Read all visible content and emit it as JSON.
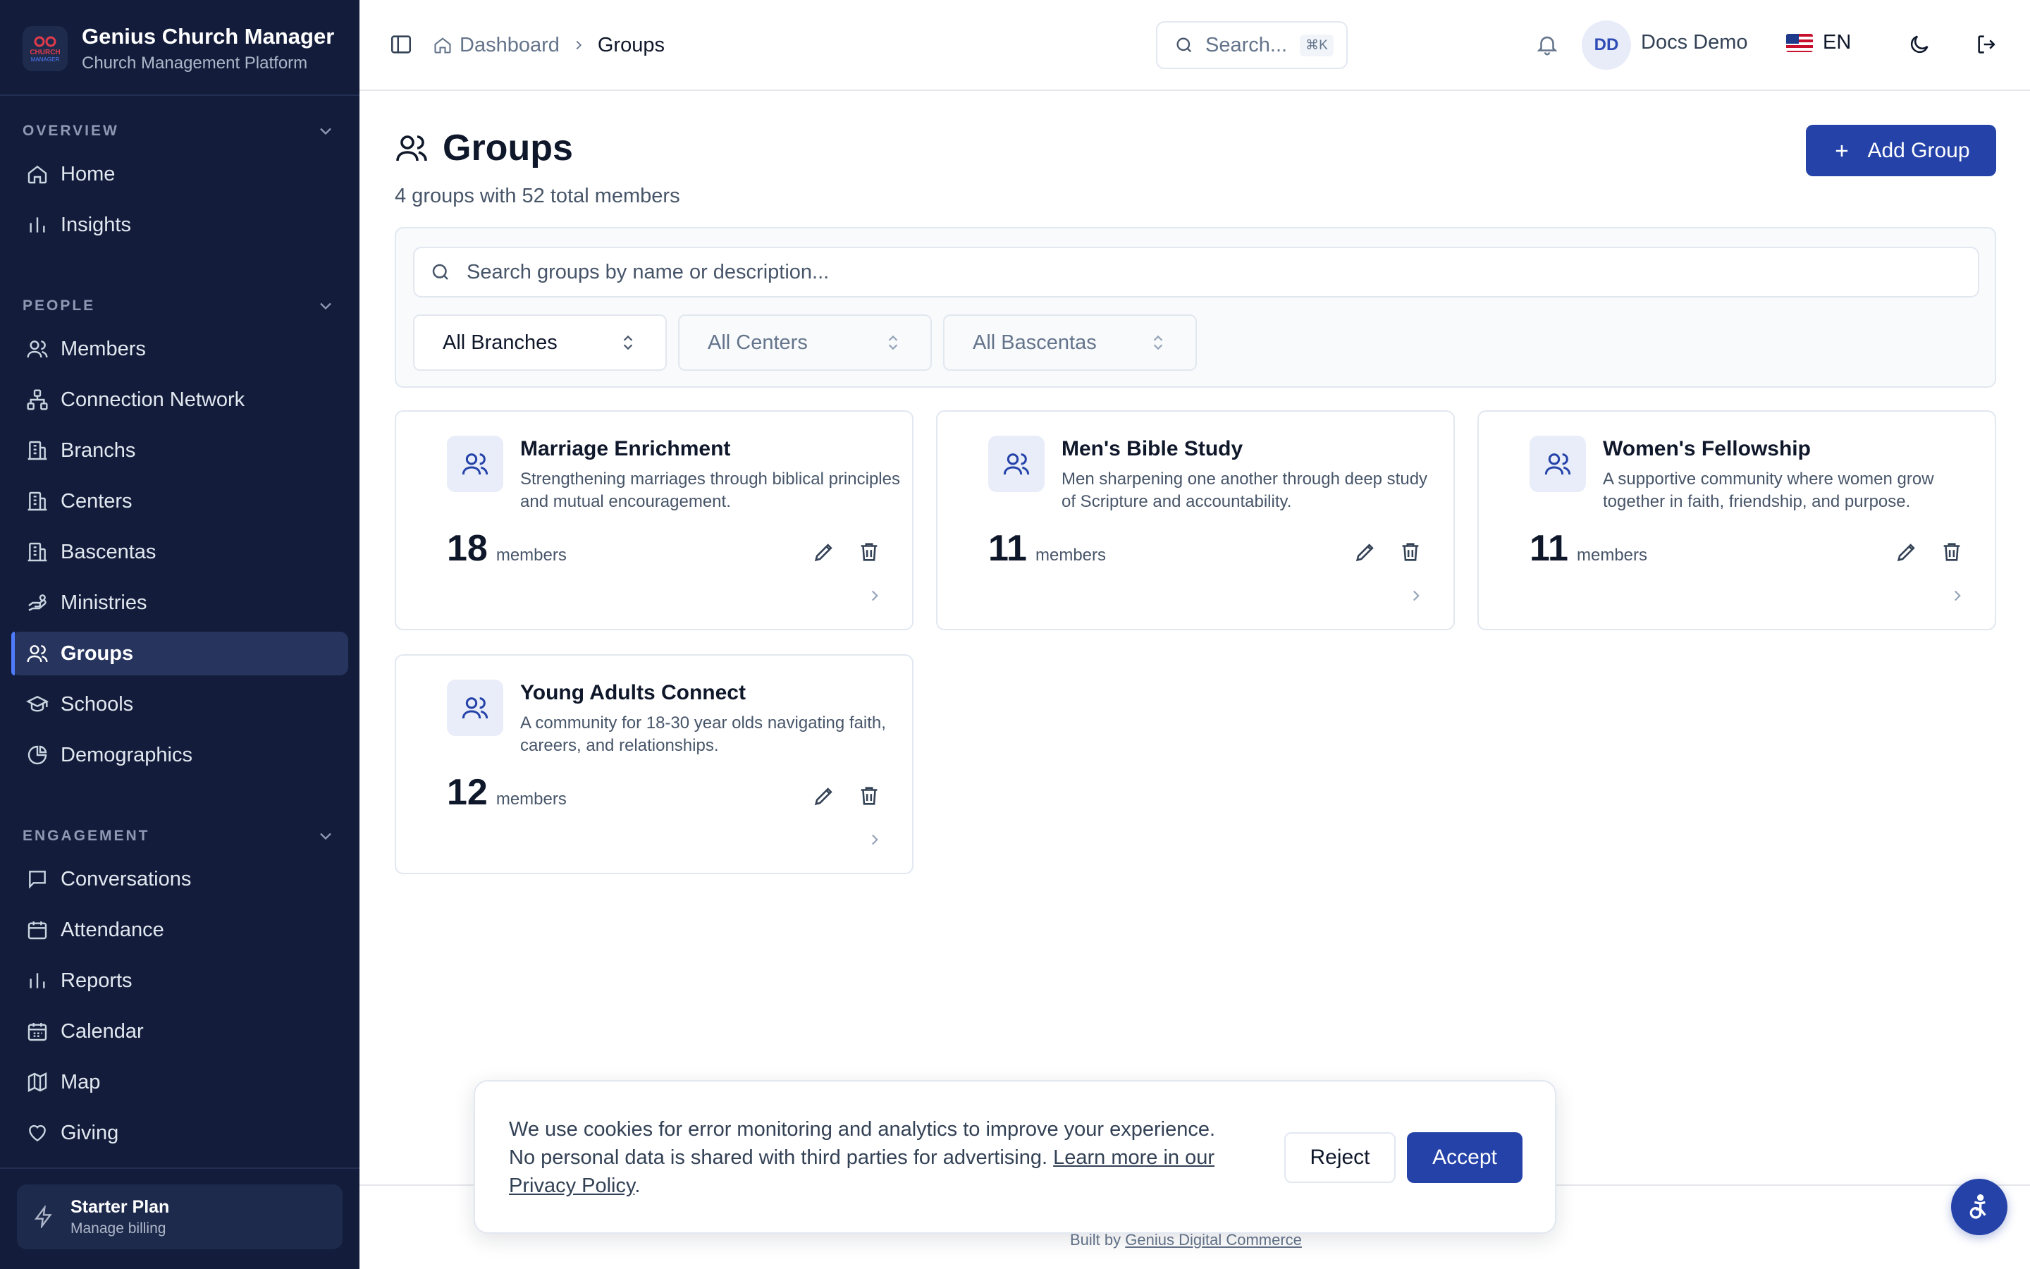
{
  "app": {
    "title": "Genius Church Manager",
    "subtitle": "Church Management Platform",
    "logo_top": "CHURCH",
    "logo_bottom": "MANAGER",
    "accent_color": "#2442a8",
    "sidebar_color": "#131d3b"
  },
  "sidebar": {
    "sections": [
      {
        "label": "OVERVIEW",
        "items": [
          {
            "label": "Home",
            "icon": "home-icon"
          },
          {
            "label": "Insights",
            "icon": "bar-chart-icon"
          }
        ]
      },
      {
        "label": "PEOPLE",
        "items": [
          {
            "label": "Members",
            "icon": "users-icon"
          },
          {
            "label": "Connection Network",
            "icon": "network-icon"
          },
          {
            "label": "Branchs",
            "icon": "building-icon"
          },
          {
            "label": "Centers",
            "icon": "building-icon"
          },
          {
            "label": "Bascentas",
            "icon": "building-icon"
          },
          {
            "label": "Ministries",
            "icon": "hand-heart-icon"
          },
          {
            "label": "Groups",
            "icon": "users-icon",
            "active": true
          },
          {
            "label": "Schools",
            "icon": "graduation-cap-icon"
          },
          {
            "label": "Demographics",
            "icon": "pie-chart-icon"
          }
        ]
      },
      {
        "label": "ENGAGEMENT",
        "items": [
          {
            "label": "Conversations",
            "icon": "message-icon"
          },
          {
            "label": "Attendance",
            "icon": "calendar-check-icon"
          },
          {
            "label": "Reports",
            "icon": "bar-chart-icon"
          },
          {
            "label": "Calendar",
            "icon": "calendar-icon"
          },
          {
            "label": "Map",
            "icon": "map-icon"
          },
          {
            "label": "Giving",
            "icon": "heart-icon"
          }
        ]
      }
    ],
    "plan": {
      "title": "Starter Plan",
      "subtitle": "Manage billing"
    }
  },
  "header": {
    "breadcrumb": {
      "root": "Dashboard",
      "current": "Groups"
    },
    "search": {
      "placeholder": "Search...",
      "shortcut": "⌘K"
    },
    "user": {
      "initials": "DD",
      "name": "Docs Demo"
    },
    "language": "EN"
  },
  "main": {
    "title": "Groups",
    "subtitle": "4 groups with 52 total members",
    "add_button": "Add Group",
    "search_placeholder": "Search groups by name or description...",
    "filters": {
      "branch": "All Branches",
      "center": "All Centers",
      "bascenta": "All Bascentas"
    },
    "members_label": "members",
    "groups": [
      {
        "name": "Marriage Enrichment",
        "description": "Strengthening marriages through biblical principles and mutual encouragement.",
        "members": "18"
      },
      {
        "name": "Men's Bible Study",
        "description": "Men sharpening one another through deep study of Scripture and accountability.",
        "members": "11"
      },
      {
        "name": "Women's Fellowship",
        "description": "A supportive community where women grow together in faith, friendship, and purpose.",
        "members": "11"
      },
      {
        "name": "Young Adults Connect",
        "description": "A community for 18-30 year olds navigating faith, careers, and relationships.",
        "members": "12"
      }
    ]
  },
  "cookie": {
    "text": "We use cookies for error monitoring and analytics to improve your experience. No personal data is shared with third parties for advertising.",
    "link_text": "Learn more in our Privacy Policy",
    "end": ".",
    "reject": "Reject",
    "accept": "Accept"
  },
  "footer": {
    "prefix": "Built by",
    "link": "Genius Digital Commerce"
  }
}
